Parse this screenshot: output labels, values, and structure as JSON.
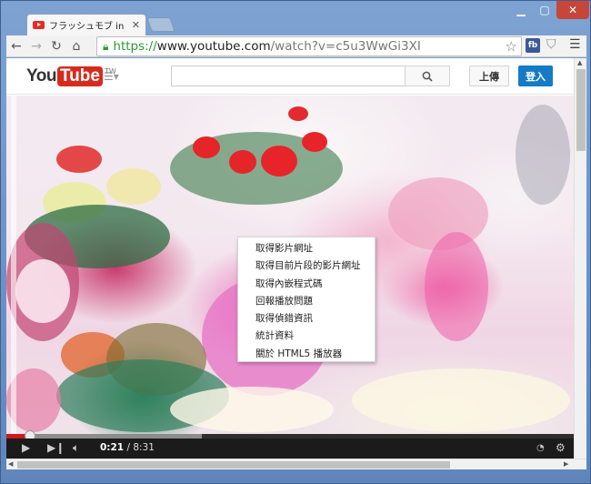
{
  "browser": {
    "tab_title": "フラッシュモブ in 静岡 -",
    "tab_close": "✕",
    "url_scheme": "https://",
    "url_host": "www.youtube.com",
    "url_path": "/watch?v=c5u3WwGi3XI",
    "ext_fb_label": "fb"
  },
  "youtube": {
    "logo_you": "You",
    "logo_tube": "Tube",
    "logo_region": "TW",
    "upload_label": "上傳",
    "signin_label": "登入"
  },
  "context_menu": {
    "items": [
      "取得影片網址",
      "取得目前片段的影片網址",
      "取得內嵌程式碼",
      "回報播放問題",
      "取得偵錯資訊",
      "統計資料",
      "關於 HTML5 播放器"
    ]
  },
  "player": {
    "current_time": "0:21",
    "separator": " / ",
    "duration": "8:31",
    "progress_played_fraction": 0.041,
    "progress_buffered_fraction": 0.344
  }
}
